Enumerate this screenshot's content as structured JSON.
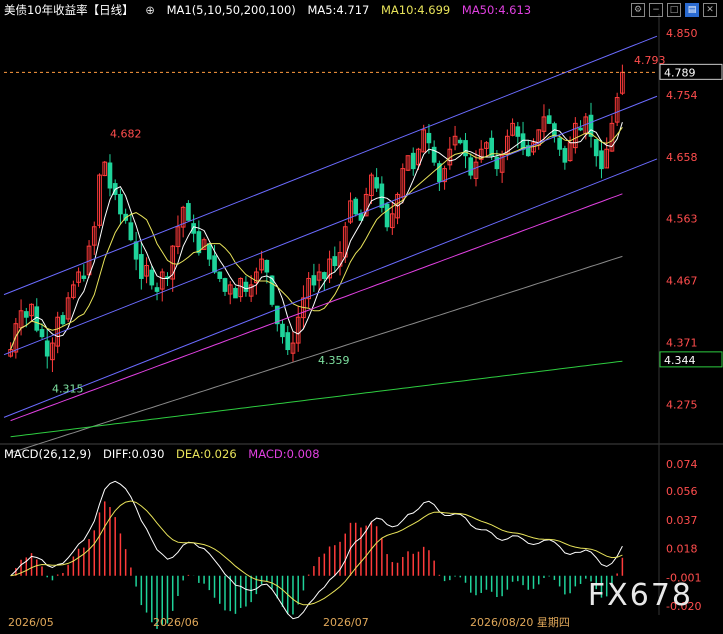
{
  "header": {
    "title": "美债10年收益率【日线】",
    "ma_label": "MA1(5,10,50,200,100)",
    "ma5": "MA5:4.717",
    "ma10": "MA10:4.699",
    "ma50": "MA50:4.613"
  },
  "macd_header": {
    "label": "MACD(26,12,9)",
    "diff": "DIFF:0.030",
    "dea": "DEA:0.026",
    "macd": "MACD:0.008"
  },
  "toolbar": {
    "icons": [
      "settings-icon",
      "minus-icon",
      "window-icon",
      "chart-icon",
      "close-icon"
    ]
  },
  "watermark": "FX678",
  "colors": {
    "up": "#ff3b3b",
    "down": "#1fd39a",
    "ma5": "#ffffff",
    "ma10": "#e8e35a",
    "ma50": "#e040e0",
    "ma100": "#8a8a8a",
    "ma200": "#2ecc40",
    "channel": "#6b6bff",
    "price_line": "#ff9c40"
  },
  "chart_data": [
    {
      "type": "candlestick",
      "title": "美债10年收益率【日线】",
      "y_ticks": [
        "4.850",
        "4.754",
        "4.658",
        "4.563",
        "4.467",
        "4.371",
        "4.275"
      ],
      "ylim": [
        4.22,
        4.87
      ],
      "current_price": "4.789",
      "price_tag_2": "4.344",
      "annotations": [
        {
          "label": "4.682",
          "type": "high"
        },
        {
          "label": "4.315",
          "type": "low"
        },
        {
          "label": "4.359",
          "type": "low"
        },
        {
          "label": "4.793",
          "type": "high"
        }
      ],
      "x_labels": [
        "2026/05",
        "2026/06",
        "2026/07",
        "2026/08/20 星期四"
      ],
      "closes": [
        4.36,
        4.4,
        4.42,
        4.41,
        4.43,
        4.39,
        4.38,
        4.35,
        4.37,
        4.41,
        4.4,
        4.44,
        4.46,
        4.48,
        4.47,
        4.52,
        4.55,
        4.63,
        4.65,
        4.61,
        4.6,
        4.57,
        4.56,
        4.53,
        4.5,
        4.47,
        4.49,
        4.46,
        4.45,
        4.48,
        4.47,
        4.52,
        4.55,
        4.58,
        4.56,
        4.54,
        4.51,
        4.53,
        4.5,
        4.48,
        4.47,
        4.45,
        4.46,
        4.44,
        4.47,
        4.45,
        4.46,
        4.48,
        4.5,
        4.48,
        4.43,
        4.4,
        4.38,
        4.36,
        4.37,
        4.41,
        4.44,
        4.47,
        4.46,
        4.48,
        4.47,
        4.5,
        4.49,
        4.51,
        4.55,
        4.59,
        4.57,
        4.56,
        4.6,
        4.63,
        4.61,
        4.58,
        4.55,
        4.57,
        4.6,
        4.64,
        4.66,
        4.64,
        4.67,
        4.7,
        4.68,
        4.65,
        4.62,
        4.64,
        4.67,
        4.69,
        4.68,
        4.66,
        4.63,
        4.65,
        4.67,
        4.68,
        4.66,
        4.64,
        4.66,
        4.69,
        4.71,
        4.69,
        4.67,
        4.66,
        4.68,
        4.7,
        4.72,
        4.71,
        4.69,
        4.67,
        4.65,
        4.68,
        4.71,
        4.7,
        4.72,
        4.69,
        4.66,
        4.64,
        4.67,
        4.71,
        4.75,
        4.789
      ],
      "ma_series": [
        {
          "name": "MA5",
          "color": "#ffffff"
        },
        {
          "name": "MA10",
          "color": "#e8e35a"
        },
        {
          "name": "MA50",
          "color": "#e040e0"
        },
        {
          "name": "MA100",
          "color": "#8a8a8a"
        },
        {
          "name": "MA200",
          "color": "#2ecc40"
        }
      ]
    },
    {
      "type": "macd",
      "title": "MACD(26,12,9)",
      "y_ticks": [
        "0.074",
        "0.056",
        "0.037",
        "0.018",
        "-0.001",
        "-0.020"
      ],
      "ylim": [
        -0.026,
        0.078
      ]
    }
  ]
}
